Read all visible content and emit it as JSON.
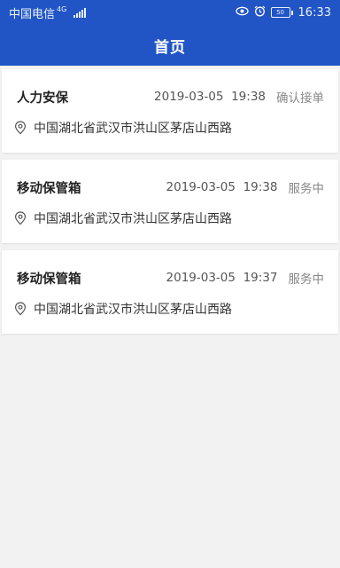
{
  "status_bar": {
    "carrier": "中国电信",
    "network": "4G",
    "battery": "50",
    "time": "16:33"
  },
  "header": {
    "title": "首页"
  },
  "orders": [
    {
      "name": "人力安保",
      "date": "2019-03-05",
      "time": "19:38",
      "status": "确认接单",
      "address": "中国湖北省武汉市洪山区茅店山西路"
    },
    {
      "name": "移动保管箱",
      "date": "2019-03-05",
      "time": "19:38",
      "status": "服务中",
      "address": "中国湖北省武汉市洪山区茅店山西路"
    },
    {
      "name": "移动保管箱",
      "date": "2019-03-05",
      "time": "19:37",
      "status": "服务中",
      "address": "中国湖北省武汉市洪山区茅店山西路"
    }
  ],
  "colors": {
    "primary": "#2155c6",
    "background": "#f2f2f2"
  }
}
